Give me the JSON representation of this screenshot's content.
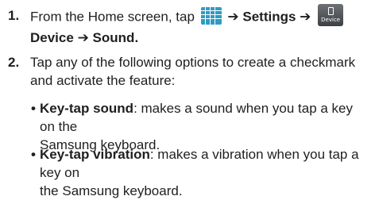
{
  "steps": [
    {
      "number": "1.",
      "intro": "From the Home screen, tap",
      "apps_icon": "apps-grid-icon",
      "arrow": "➔",
      "settings": "Settings",
      "device_icon_caption": "Device",
      "device_label": "Device",
      "sound_label": "Sound",
      "end": "."
    },
    {
      "number": "2.",
      "text_line1": "Tap any of the following options to create a checkmark",
      "text_line2": "and activate the feature:"
    }
  ],
  "bullets": [
    {
      "dot": "•",
      "term": "Key-tap sound",
      "desc_line1": ": makes a sound when you tap a key on the",
      "desc_line2": "Samsung keyboard."
    },
    {
      "dot": "•",
      "term": "Key-tap vibration",
      "desc_line1": ": makes a vibration when you tap a key on",
      "desc_line2": "the Samsung keyboard."
    }
  ],
  "colors": {
    "apps_icon_bg": "#2e9bc4",
    "device_icon_bg": "#4a4d51",
    "text": "#1f1f1f"
  }
}
